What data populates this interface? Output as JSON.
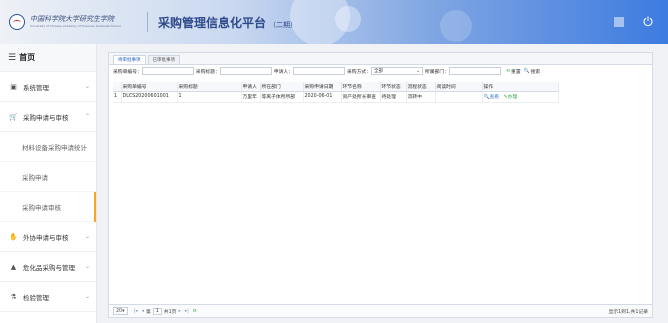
{
  "header": {
    "school_name": "中国科学院大学研究生学院",
    "school_en": "University of Chinese Academy of Sciences Graduate School",
    "platform_title": "采购管理信息化平台",
    "phase": "（二期）"
  },
  "sidebar": {
    "home": "首页",
    "items": [
      {
        "label": "系统管理",
        "icon": "monitor-icon"
      },
      {
        "label": "采购申请与审核",
        "icon": "cart-icon",
        "expanded": true
      },
      {
        "label": "材料设备采购申请统计",
        "sub": true
      },
      {
        "label": "采购申请",
        "sub": true
      },
      {
        "label": "采购申请审核",
        "sub": true,
        "active": true
      },
      {
        "label": "外协申请与审核",
        "icon": "handshake-icon"
      },
      {
        "label": "危化品采购与管理",
        "icon": "warning-icon"
      },
      {
        "label": "检验管理",
        "icon": "flask-icon"
      }
    ]
  },
  "tabs": [
    "待审批事项",
    "已审批事项"
  ],
  "filters": {
    "order_no_label": "采购单编号：",
    "title_label": "采购标题：",
    "applicant_label": "申请人：",
    "method_label": "采购方式：",
    "method_value": "全部",
    "dept_label": "所属部门：",
    "reset_label": "重置",
    "search_label": "搜索"
  },
  "table": {
    "columns": [
      "",
      "采购单编号",
      "采购标题",
      "申请人",
      "所在部门",
      "采购申请日期",
      "环节名称",
      "环节状态",
      "流程状态",
      "阅读时间",
      "操作"
    ],
    "rows": [
      {
        "cells": [
          "1",
          "DLCS20200601001",
          "1",
          "万里年",
          "等离子体所所部",
          "2020-06-01",
          "资产处所长审查",
          "待处理",
          "流转中",
          ""
        ],
        "actions": {
          "view": "查看",
          "edit": "办理"
        }
      }
    ]
  },
  "pager": {
    "page_size": "20",
    "page_prefix": "第",
    "page_value": "1",
    "page_suffix": "共1页",
    "info": "显示1到1,共1记录"
  },
  "colors": {
    "accent": "#1f5fbf",
    "green": "#3aa34a",
    "active_marker": "#f6a623"
  }
}
